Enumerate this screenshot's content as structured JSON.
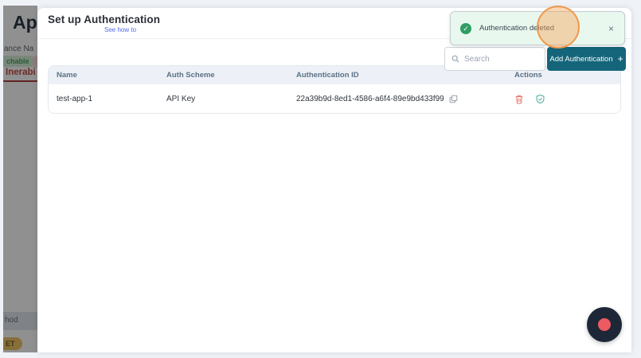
{
  "backdrop": {
    "app_title_fragment": "App",
    "instance_label_fragment": "ance Na",
    "reachable_badge_fragment": "chable",
    "vulnerabilities_tab_fragment": "Inerabi",
    "method_header_fragment": "hod",
    "get_badge_fragment": "ET"
  },
  "modal": {
    "title": "Set up Authentication",
    "see_how_to": "See how to",
    "toast": {
      "message": "Authentication deleted",
      "close": "×"
    },
    "search": {
      "placeholder": "Search"
    },
    "add_button": {
      "label": "Add Authentication",
      "plus": "+"
    },
    "table": {
      "headers": [
        "Name",
        "Auth Scheme",
        "Authentication ID",
        "Actions"
      ],
      "rows": [
        {
          "name": "test-app-1",
          "auth_scheme": "API Key",
          "authentication_id": "22a39b9d-8ed1-4586-a6f4-89e9bd433f99"
        }
      ]
    }
  },
  "icons": {
    "toast_success": "check-circle",
    "copy": "copy",
    "delete": "trash",
    "verify": "shield-check",
    "search": "magnifier",
    "record": "record-dot"
  },
  "colors": {
    "accent_teal": "#15657a",
    "toast_bg_green": "#e9f8ee",
    "toast_icon_green": "#2f9e63",
    "danger_red": "#e4746a",
    "verify_teal": "#56b3a6",
    "highlight_orange": "#ef9a4d",
    "record_navy": "#1d2737",
    "record_red": "#ee5a62",
    "reachable_green": "#3e9d4c",
    "vulnerability_red": "#c23f38",
    "get_badge_yellow": "#efc15f"
  }
}
